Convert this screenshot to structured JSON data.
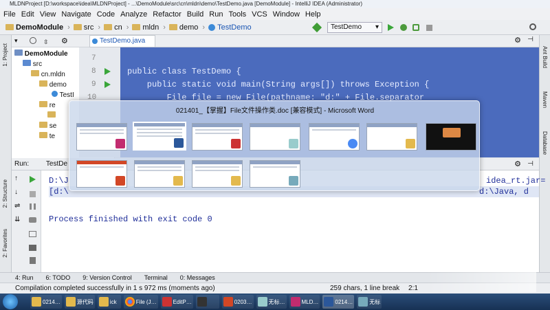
{
  "window_title": "MLDNProject [D:\\workspace\\idea\\MLDNProject] - ...\\DemoModule\\src\\cn\\mldn\\demo\\TestDemo.java [DemoModule] - IntelliJ IDEA (Administrator)",
  "menu": [
    "File",
    "Edit",
    "View",
    "Navigate",
    "Code",
    "Analyze",
    "Refactor",
    "Build",
    "Run",
    "Tools",
    "VCS",
    "Window",
    "Help"
  ],
  "breadcrumbs": [
    "DemoModule",
    "src",
    "cn",
    "mldn",
    "demo",
    "TestDemo"
  ],
  "run_config": "TestDemo",
  "left_strip": {
    "project": "1: Project",
    "structure": "2: Structure",
    "favorites": "2: Favorites"
  },
  "right_strip": {
    "ant": "Ant Build",
    "maven": "Maven",
    "database": "Database"
  },
  "project_tree": [
    {
      "label": "DemoModule",
      "indent": 0
    },
    {
      "label": "src",
      "indent": 1
    },
    {
      "label": "cn.mldn",
      "indent": 2
    },
    {
      "label": "demo",
      "indent": 3
    },
    {
      "label": "TestI",
      "indent": 4
    },
    {
      "label": "re",
      "indent": 3
    },
    {
      "label": "",
      "indent": 3
    },
    {
      "label": "se",
      "indent": 3
    },
    {
      "label": "te",
      "indent": 3
    }
  ],
  "editor_tab": "TestDemo.java",
  "line_numbers": [
    "7",
    "8",
    "9",
    "10"
  ],
  "code_lines": [
    "public class TestDemo {",
    "    public static void main(String args[]) throws Exception {",
    "        File file = new File(pathname: \"d:\" + File.separator"
  ],
  "run_panel": {
    "label": "Run:",
    "tab": "TestDe"
  },
  "console": {
    "line1": "D:\\J",
    "line1_right": "idea_rt.jar=",
    "line2": "[d:\\",
    "line2_right": "d:\\Java, d",
    "finished": "Process finished with exit code 0"
  },
  "bottom_tabs": [
    "4: Run",
    "6: TODO",
    "9: Version Control",
    "Terminal",
    "0: Messages"
  ],
  "status": {
    "message": "Compilation completed successfully in 1 s 972 ms (moments ago)",
    "chars": "259 chars, 1 line break",
    "position": "2:1"
  },
  "switcher_title": "021401_【掌握】File文件操作类.doc [兼容模式] - Microsoft Word",
  "taskbar_items": [
    "0214…",
    "源代码",
    "ick",
    "File (J…",
    "EditP…",
    "0203…",
    "无标…",
    "MLD…",
    "0214…",
    "无标"
  ],
  "colors": {
    "editor_bg": "#4b6bbd",
    "taskbar": "#1f3d66",
    "accent": "#1a55b3"
  }
}
